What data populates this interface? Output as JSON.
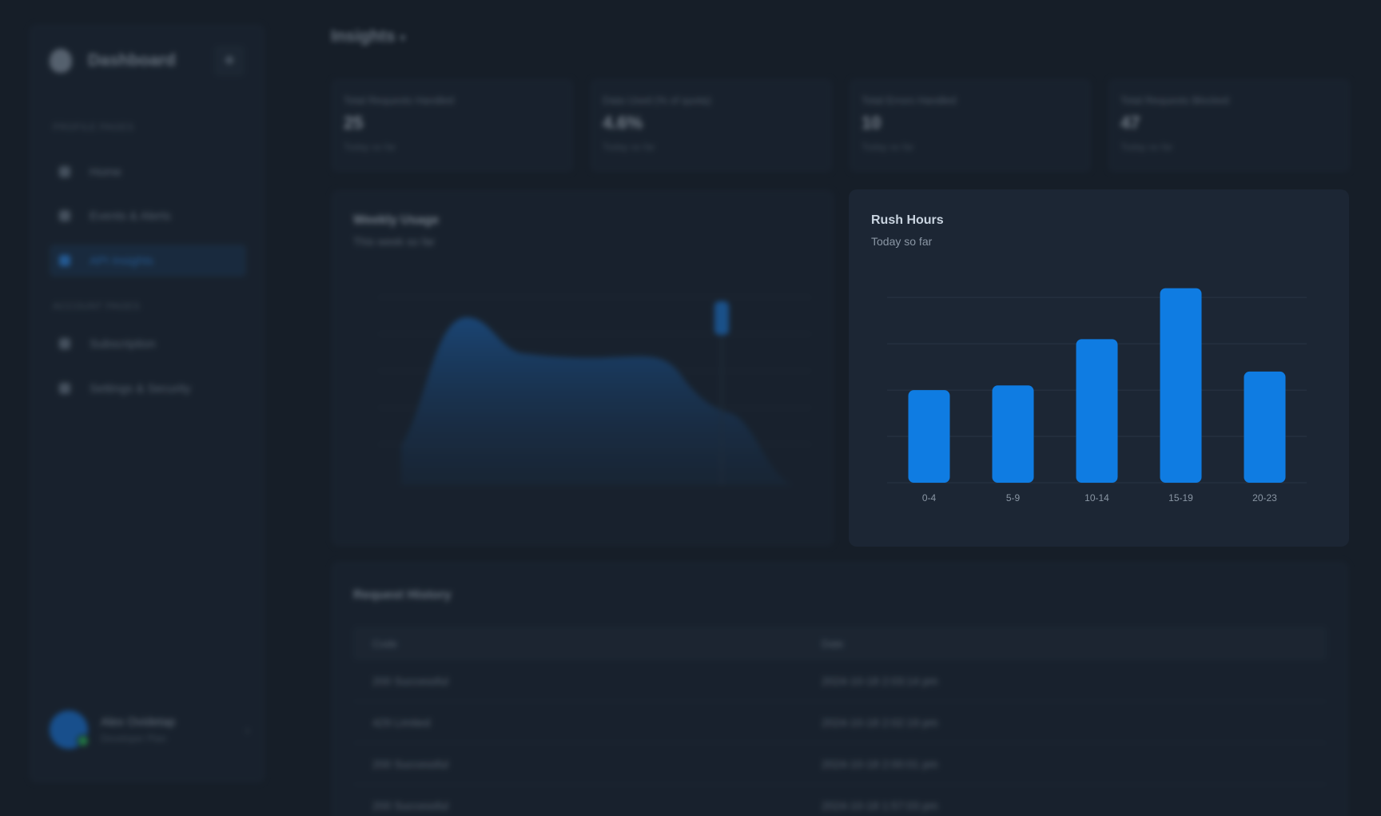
{
  "sidebar": {
    "title": "Dashboard",
    "section1": "PROFILE PAGES",
    "section2": "ACCOUNT PAGES",
    "items": [
      {
        "label": "Home"
      },
      {
        "label": "Events & Alerts"
      },
      {
        "label": "API Insights",
        "active": true
      },
      {
        "label": "Subscription"
      },
      {
        "label": "Settings & Security"
      }
    ],
    "user": {
      "name": "Alex Ovidetap",
      "sub": "Developer Plan"
    }
  },
  "header": {
    "title": "Insights"
  },
  "stats": [
    {
      "label": "Total Requests Handled",
      "value": "25",
      "sub": "Today so far"
    },
    {
      "label": "Data Used (% of quota)",
      "value": "4.6%",
      "sub": "Today so far"
    },
    {
      "label": "Total Errors Handled",
      "value": "10",
      "sub": "Today so far"
    },
    {
      "label": "Total Requests Blocked",
      "value": "47",
      "sub": "Today so far"
    }
  ],
  "weekly": {
    "title": "Weekly Usage",
    "sub": "This week so far"
  },
  "rush": {
    "title": "Rush Hours",
    "sub": "Today so far"
  },
  "chart_data": {
    "type": "bar",
    "title": "Rush Hours",
    "subtitle": "Today so far",
    "categories": [
      "0-4",
      "5-9",
      "10-14",
      "15-19",
      "20-23"
    ],
    "values": [
      20,
      21,
      31,
      42,
      24
    ],
    "ylim": [
      0,
      44
    ],
    "grid": true,
    "color": "#0f7ce2"
  },
  "history": {
    "title": "Request History",
    "columns": [
      "Code",
      "Date"
    ],
    "rows": [
      {
        "code": "200 Successful",
        "date": "2024-10-18 2:03:14 pm"
      },
      {
        "code": "429 Limited",
        "date": "2024-10-18 2:02:19 pm"
      },
      {
        "code": "200 Successful",
        "date": "2024-10-18 2:00:01 pm"
      },
      {
        "code": "200 Successful",
        "date": "2024-10-18 1:57:03 pm"
      }
    ]
  },
  "colors": {
    "background": "#161e28",
    "card": "#1c2634",
    "accent": "#0f7ce2"
  }
}
